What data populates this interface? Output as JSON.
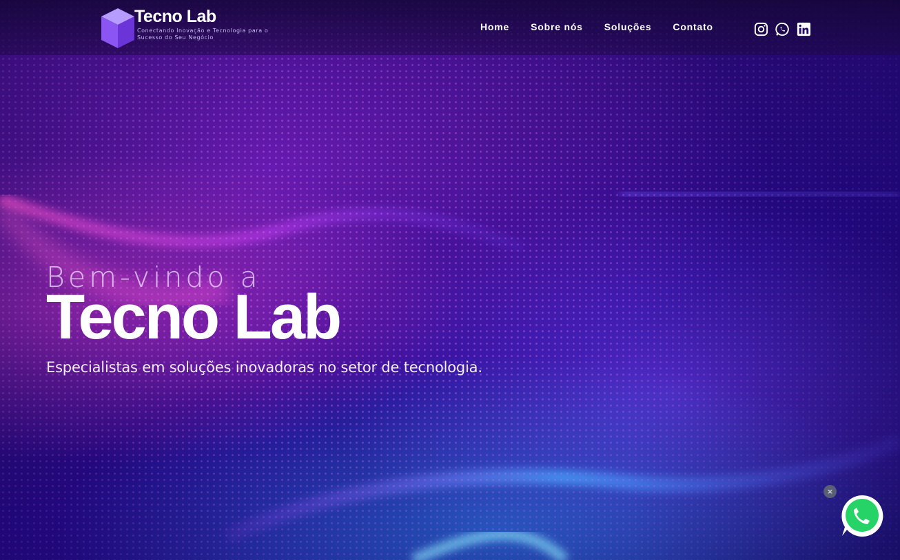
{
  "header": {
    "brand_name": "Tecno Lab",
    "tagline": "Conectando Inovação e Tecnologia para o Sucesso do Seu Negócio",
    "nav": [
      {
        "label": "Home"
      },
      {
        "label": "Sobre nós"
      },
      {
        "label": "Soluções"
      },
      {
        "label": "Contato"
      }
    ],
    "social_icons": [
      "instagram-icon",
      "whatsapp-icon",
      "linkedin-icon"
    ]
  },
  "hero": {
    "greeting": "Bem-vindo a",
    "title": "Tecno Lab",
    "subtitle": "Especialistas em soluções inovadoras no setor de tecnologia."
  },
  "floating": {
    "close_symbol": "×",
    "whatsapp_icon": "whatsapp-icon"
  },
  "colors": {
    "background": "#2a0a78",
    "accent_pink": "#e83cdc",
    "accent_blue": "#28aaff",
    "whatsapp_green": "#25d366",
    "text": "#ffffff"
  }
}
